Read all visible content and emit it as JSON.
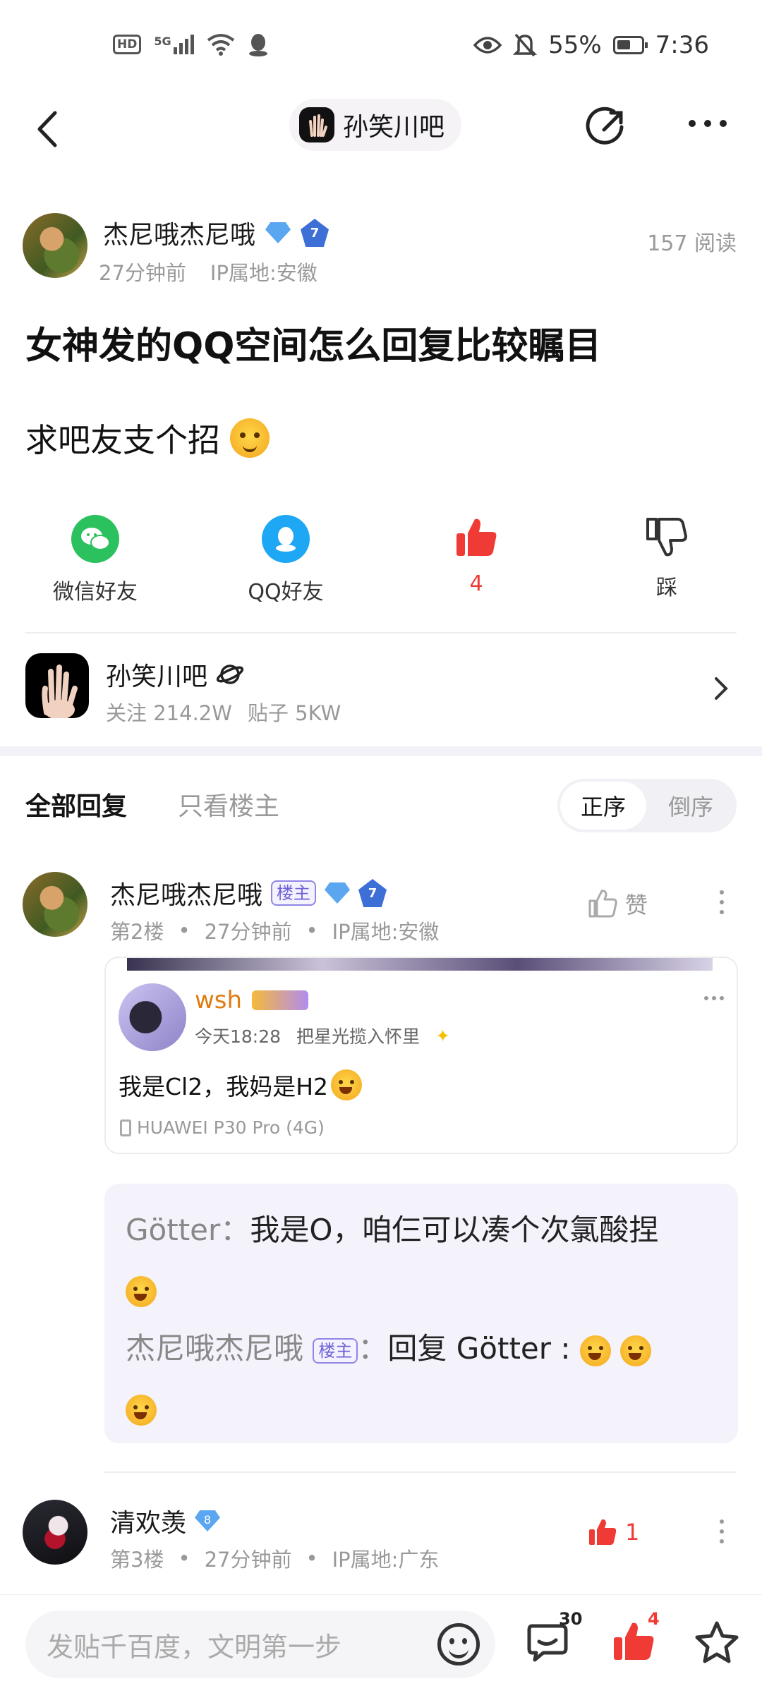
{
  "status_bar": {
    "hd": "HD",
    "network": "5G",
    "battery": "55%",
    "time": "7:36"
  },
  "nav": {
    "forum_name": "孙笑川吧"
  },
  "post": {
    "author": "杰尼哦杰尼哦",
    "author_level": "7",
    "time": "27分钟前",
    "ip": "IP属地:安徽",
    "reads": "157 阅读",
    "title": "女神发的QQ空间怎么回复比较瞩目",
    "body": "求吧友支个招"
  },
  "actions": {
    "wechat": "微信好友",
    "qq": "QQ好友",
    "like_count": "4",
    "dislike": "踩"
  },
  "forum": {
    "name": "孙笑川吧",
    "follow": "关注 214.2W",
    "posts": "贴子 5KW"
  },
  "tabs": {
    "all": "全部回复",
    "owner_only": "只看楼主",
    "sort_asc": "正序",
    "sort_desc": "倒序"
  },
  "reply1": {
    "author": "杰尼哦杰尼哦",
    "owner_tag": "楼主",
    "level": "7",
    "floor": "第2楼",
    "time": "27分钟前",
    "ip": "IP属地:安徽",
    "like_label": "赞",
    "card": {
      "user": "wsh",
      "time": "今天18:28",
      "signature": "把星光揽入怀里",
      "text": "我是Cl2，我妈是H2",
      "device": "HUAWEI P30 Pro (4G)"
    },
    "quotes": [
      {
        "user": "Götter",
        "sep": "：",
        "text": "我是O，咱仨可以凑个次氯酸捏"
      },
      {
        "user": "杰尼哦杰尼哦",
        "tag": "楼主",
        "sep": "：",
        "text": "回复 Götter :"
      }
    ]
  },
  "reply2": {
    "author": "清欢羡",
    "gem_level": "8",
    "floor": "第3楼",
    "time": "27分钟前",
    "ip": "IP属地:广东",
    "like_count": "1"
  },
  "bottom_bar": {
    "placeholder": "发贴千百度，文明第一步",
    "comment_count": "30",
    "like_count": "4"
  },
  "colors": {
    "like_red": "#f03a35",
    "owner_tag": "#6d63d8",
    "wechat_green": "#2ac15e",
    "qq_blue": "#1ea7f5"
  }
}
